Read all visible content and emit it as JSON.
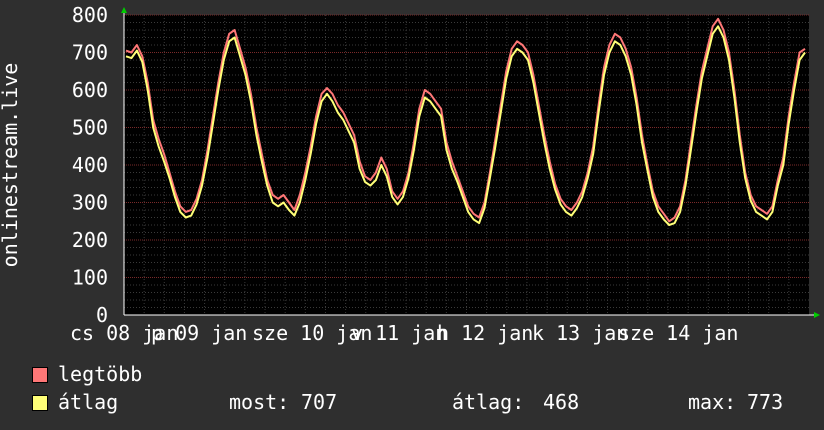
{
  "chart_data": {
    "type": "line",
    "ylabel": "onlinestream.live",
    "ylim": [
      0,
      800
    ],
    "y_ticks": [
      "0",
      "100",
      "200",
      "300",
      "400",
      "500",
      "600",
      "700",
      "800"
    ],
    "x_tick_labels": [
      "cs 08 jan",
      "p 09 jan",
      "sze 10 jan",
      "v 11 jan",
      "h 12 jan",
      "k 13 jan",
      "sze 14 jan"
    ],
    "grid": true,
    "legend_placement": "bottom-left",
    "series": [
      {
        "name": "legtöbb",
        "color": "#ff7777",
        "values": [
          705,
          700,
          720,
          690,
          620,
          520,
          470,
          430,
          380,
          330,
          290,
          275,
          280,
          310,
          360,
          440,
          530,
          620,
          700,
          750,
          760,
          710,
          660,
          590,
          500,
          430,
          360,
          320,
          310,
          320,
          300,
          280,
          320,
          380,
          450,
          530,
          590,
          605,
          590,
          560,
          540,
          510,
          480,
          410,
          370,
          360,
          380,
          420,
          390,
          330,
          310,
          330,
          380,
          460,
          550,
          600,
          590,
          570,
          550,
          460,
          410,
          370,
          330,
          290,
          270,
          260,
          300,
          380,
          470,
          560,
          650,
          710,
          730,
          720,
          700,
          640,
          560,
          480,
          410,
          350,
          310,
          290,
          280,
          300,
          330,
          380,
          450,
          560,
          660,
          720,
          750,
          740,
          710,
          660,
          580,
          480,
          400,
          330,
          290,
          270,
          250,
          260,
          290,
          360,
          460,
          560,
          650,
          710,
          770,
          790,
          760,
          700,
          600,
          480,
          380,
          320,
          290,
          280,
          270,
          290,
          360,
          420,
          530,
          620,
          700,
          710
        ]
      },
      {
        "name": "átlag",
        "color": "#ffff77",
        "values": [
          690,
          685,
          705,
          675,
          600,
          500,
          450,
          410,
          365,
          315,
          275,
          260,
          265,
          295,
          345,
          420,
          510,
          600,
          680,
          730,
          740,
          690,
          640,
          570,
          480,
          410,
          345,
          300,
          290,
          300,
          280,
          265,
          300,
          360,
          430,
          510,
          570,
          590,
          570,
          540,
          520,
          490,
          460,
          390,
          355,
          345,
          360,
          400,
          370,
          315,
          295,
          315,
          365,
          440,
          530,
          580,
          570,
          550,
          530,
          440,
          390,
          355,
          315,
          275,
          255,
          245,
          285,
          365,
          450,
          540,
          630,
          690,
          710,
          700,
          680,
          620,
          540,
          460,
          390,
          335,
          295,
          275,
          265,
          285,
          315,
          365,
          430,
          540,
          640,
          700,
          730,
          720,
          690,
          640,
          560,
          460,
          385,
          315,
          275,
          255,
          240,
          245,
          275,
          345,
          440,
          540,
          630,
          690,
          750,
          770,
          740,
          680,
          580,
          460,
          365,
          305,
          275,
          265,
          255,
          275,
          345,
          400,
          510,
          600,
          680,
          700
        ]
      }
    ],
    "stats": {
      "now_label": "most:",
      "now_value": "707",
      "avg_label": "átlag:",
      "avg_value": "468",
      "max_label": "max:",
      "max_value": "773"
    }
  }
}
